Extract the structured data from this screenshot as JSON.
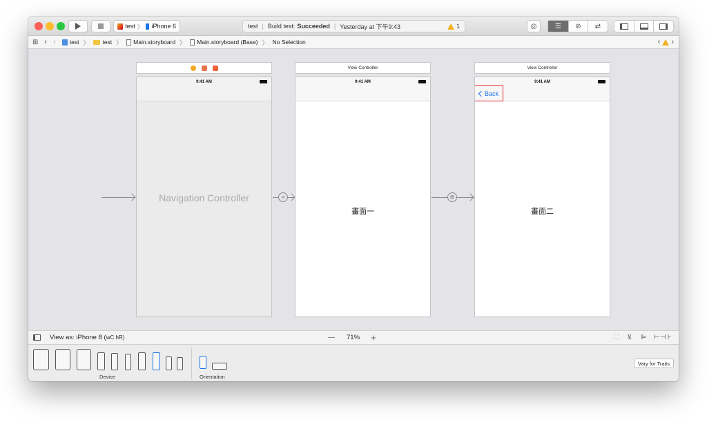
{
  "toolbar": {
    "scheme_name": "test",
    "device_name": "iPhone 6",
    "status_project": "test",
    "status_build_prefix": "Build test:",
    "status_build_result": "Succeeded",
    "status_time": "Yesterday at 下午9:43",
    "warning_count": "1"
  },
  "jumpbar": {
    "items": [
      "test",
      "test",
      "Main.storyboard",
      "Main.storyboard (Base)",
      "No Selection"
    ]
  },
  "canvas": {
    "nav_controller_label": "Navigation Controller",
    "vc1_header": "View Controller",
    "vc2_header": "View Controller",
    "status_time": "9:41 AM",
    "vc1_screen_label": "畫面一",
    "vc2_screen_label": "畫面二",
    "back_label": "Back"
  },
  "bottombar": {
    "view_as_label": "View as: iPhone 8 (",
    "view_as_suffix": "wC hR)",
    "zoom_minus": "—",
    "zoom_level": "71%",
    "zoom_plus": "+"
  },
  "devicebar": {
    "device_label": "Device",
    "orientation_label": "Orientation",
    "vary_button": "Vary for Traits"
  },
  "colors": {
    "close": "#fc5f57",
    "minimize": "#fdbc2e",
    "zoom": "#28c840",
    "accent": "#1a73e8",
    "highlight": "#e02020",
    "warning": "#f2b01e"
  }
}
